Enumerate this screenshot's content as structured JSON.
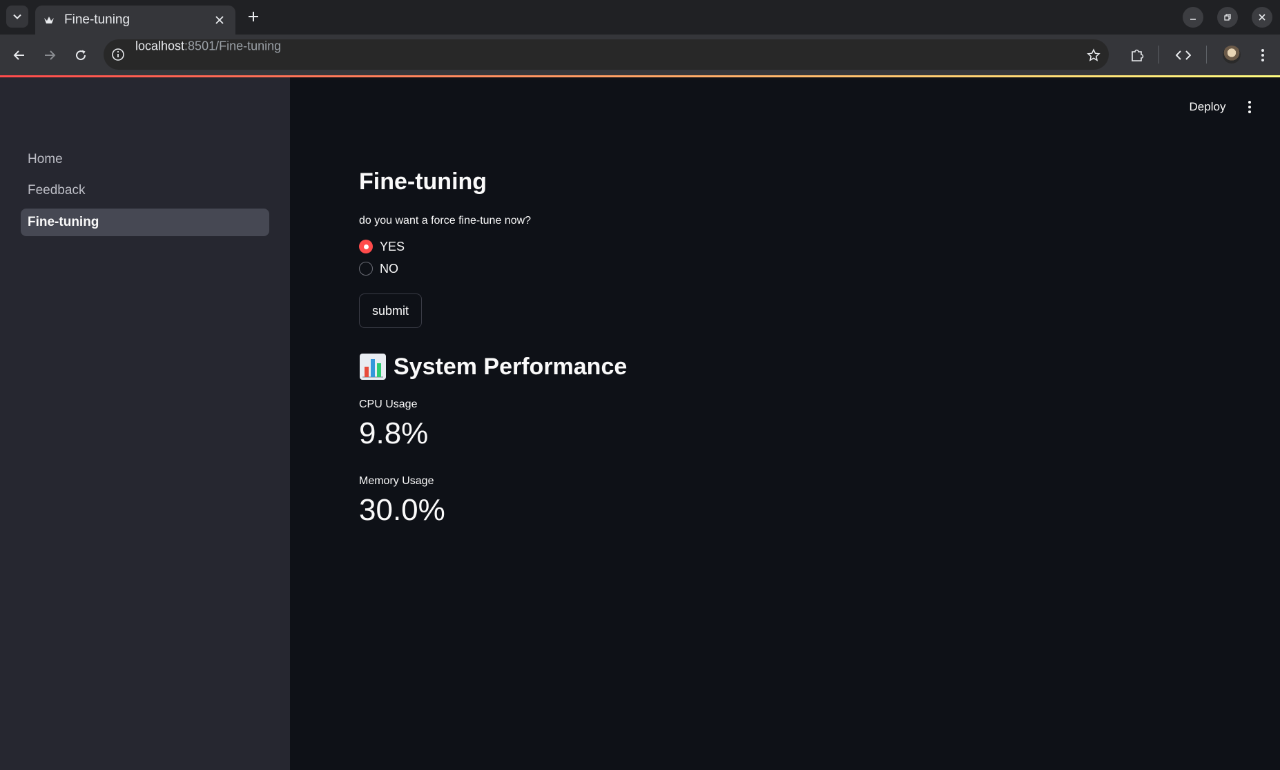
{
  "browser": {
    "tab_title": "Fine-tuning",
    "url_host": "localhost",
    "url_path": ":8501/Fine-tuning"
  },
  "header": {
    "deploy_label": "Deploy"
  },
  "sidebar": {
    "items": [
      {
        "label": "Home",
        "active": false
      },
      {
        "label": "Feedback",
        "active": false
      },
      {
        "label": "Fine-tuning",
        "active": true
      }
    ]
  },
  "main": {
    "title": "Fine-tuning",
    "question": "do you want a force fine-tune now?",
    "options": [
      {
        "label": "YES",
        "selected": true
      },
      {
        "label": "NO",
        "selected": false
      }
    ],
    "submit_label": "submit",
    "section_title": "System Performance",
    "section_icon": "bar-chart-icon",
    "metrics": [
      {
        "label": "CPU Usage",
        "value": "9.8%"
      },
      {
        "label": "Memory Usage",
        "value": "30.0%"
      }
    ]
  },
  "colors": {
    "accent": "#ff4b4b",
    "sidebar_bg": "#262730",
    "main_bg": "#0e1117"
  }
}
